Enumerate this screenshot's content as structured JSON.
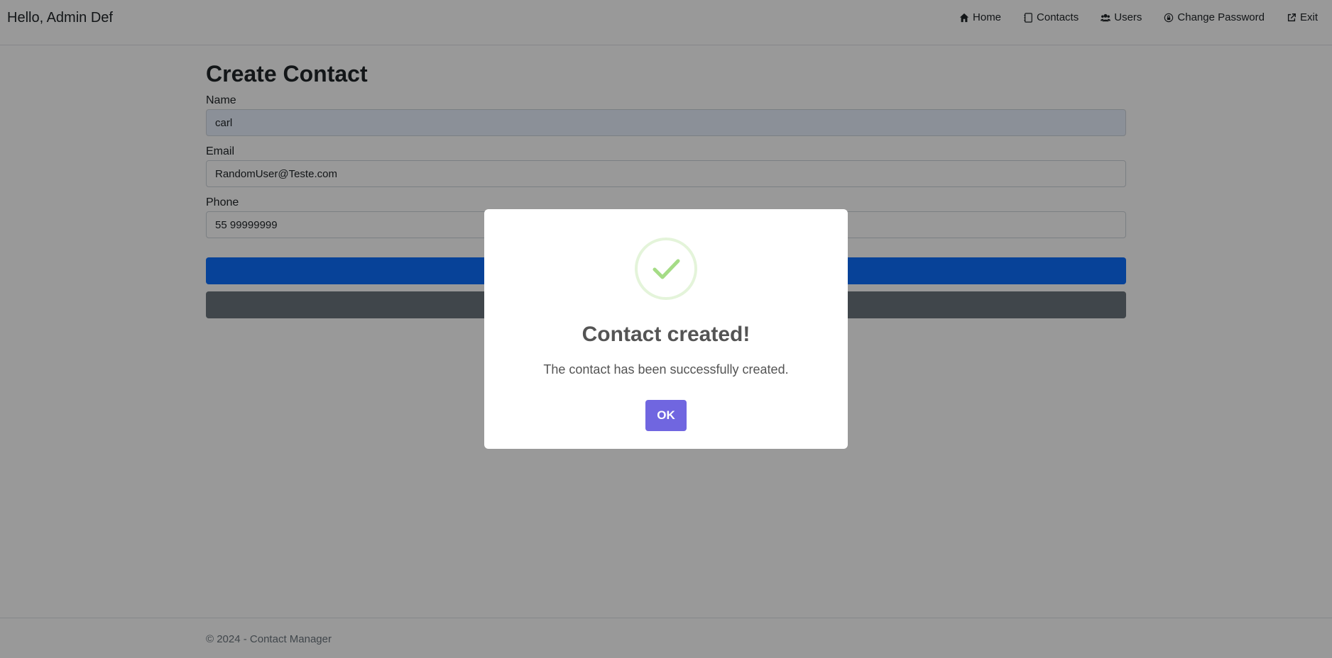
{
  "navbar": {
    "greeting": "Hello, Admin Def",
    "links": [
      {
        "label": "Home",
        "icon": "home-icon"
      },
      {
        "label": "Contacts",
        "icon": "address-book-icon"
      },
      {
        "label": "Users",
        "icon": "users-icon"
      },
      {
        "label": "Change Password",
        "icon": "lock-icon"
      },
      {
        "label": "Exit",
        "icon": "external-link-icon"
      }
    ]
  },
  "form": {
    "title": "Create Contact",
    "name_label": "Name",
    "name_value": "carl",
    "email_label": "Email",
    "email_value": "RandomUser@Teste.com",
    "phone_label": "Phone",
    "phone_value": "55 99999999",
    "submit_label": "",
    "back_label": ""
  },
  "footer": {
    "text": "© 2024 - Contact Manager"
  },
  "modal": {
    "icon": "check-icon",
    "title": "Contact created!",
    "text": "The contact has been successfully created.",
    "ok_label": "OK"
  },
  "colors": {
    "primary": "#0d6efd",
    "secondary": "#6c757d",
    "modal_button": "#7066e0",
    "success": "#a5dc86"
  }
}
